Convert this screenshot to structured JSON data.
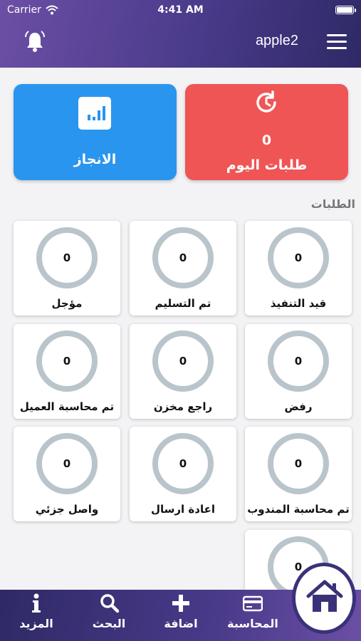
{
  "status_bar": {
    "carrier": "Carrier",
    "time": "4:41 AM"
  },
  "header": {
    "username": "apple2",
    "bell_icon": "bell-icon",
    "menu_icon": "hamburger-menu-icon"
  },
  "top_cards": {
    "today": {
      "count": "0",
      "label": "طلبات اليوم",
      "icon": "clock-refresh-icon",
      "color": "#f05555"
    },
    "achievement": {
      "label": "الانجاز",
      "icon": "bar-chart-icon",
      "color": "#2a95ee"
    }
  },
  "orders_section_title": "الطلبات",
  "order_cells": [
    {
      "label": "قيد التنفيذ",
      "count": "0"
    },
    {
      "label": "تم التسليم",
      "count": "0"
    },
    {
      "label": "مؤجل",
      "count": "0"
    },
    {
      "label": "رفض",
      "count": "0"
    },
    {
      "label": "راجع مخزن",
      "count": "0"
    },
    {
      "label": "تم محاسبة العميل",
      "count": "0"
    },
    {
      "label": "تم محاسبة المندوب",
      "count": "0"
    },
    {
      "label": "اعادة ارسال",
      "count": "0"
    },
    {
      "label": "واصل جزئي",
      "count": "0"
    },
    {
      "label": "",
      "count": "0"
    }
  ],
  "bottom_nav": [
    {
      "label": "المحاسبة",
      "icon": "credit-card-icon"
    },
    {
      "label": "اضافة",
      "icon": "plus-icon"
    },
    {
      "label": "البحث",
      "icon": "search-icon"
    },
    {
      "label": "المزيد",
      "icon": "info-icon"
    }
  ],
  "home_button_icon": "home-icon",
  "colors": {
    "header_primary": "#4a3a8a",
    "ring": "#b9c5cb"
  }
}
